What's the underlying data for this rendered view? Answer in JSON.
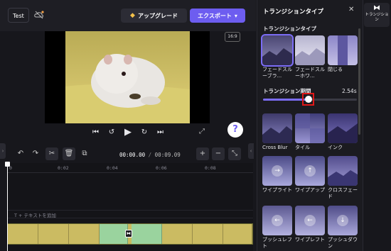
{
  "topbar": {
    "project_name": "Test",
    "upgrade_label": "アップグレード",
    "export_label": "エクスポート",
    "export_chevron": "⌄"
  },
  "preview": {
    "aspect_ratio": "16:9",
    "help_label": "?"
  },
  "timeline": {
    "current_time": "00:00.00",
    "total_time": "00:09.09",
    "ruler_ticks": [
      "0",
      "0:02",
      "0:04",
      "0:06",
      "0:08"
    ],
    "text_track_placeholder": "T  + テキストを追加"
  },
  "panel": {
    "title": "トランジションタイプ",
    "section_label": "トランジションタイプ",
    "duration_label": "トランジション期間",
    "duration_value": "2.54s",
    "duration_fraction": 0.48,
    "transitions": [
      {
        "label": "フェードスルーブラ...",
        "selected": true,
        "colors": [
          "#4a4672",
          "#8e8bb8"
        ]
      },
      {
        "label": "フェードスルーホワ...",
        "selected": false,
        "colors": [
          "#b6b4cf",
          "#eceaf6"
        ]
      },
      {
        "label": "閉じる",
        "selected": false,
        "colors": [
          "#8c86c8",
          "#c4c0e6"
        ]
      },
      {
        "label": "Cross Blur",
        "selected": false,
        "colors": [
          "#3e3a6a",
          "#8a86c6"
        ]
      },
      {
        "label": "タイル",
        "selected": false,
        "colors": [
          "#3f3d78",
          "#9b96d4"
        ]
      },
      {
        "label": "インク",
        "selected": false,
        "colors": [
          "#3a3470",
          "#7c74c0"
        ]
      },
      {
        "label": "ワイプライト",
        "selected": false,
        "colors": [
          "#4b4a86",
          "#a9a8dc"
        ]
      },
      {
        "label": "ワイプアップ",
        "selected": false,
        "colors": [
          "#4b4a86",
          "#a9a8dc"
        ]
      },
      {
        "label": "クロスフェード",
        "selected": false,
        "colors": [
          "#514c8c",
          "#a39ed6"
        ]
      },
      {
        "label": "ブッシュレフト",
        "selected": false,
        "colors": [
          "#5b5890",
          "#b4b2e0"
        ]
      },
      {
        "label": "ワイプレフト",
        "selected": false,
        "colors": [
          "#5b5890",
          "#b4b2e0"
        ]
      },
      {
        "label": "プッシュダウン",
        "selected": false,
        "colors": [
          "#4f4c88",
          "#aaa8da"
        ]
      }
    ],
    "arrow_icons": [
      "→",
      "↑",
      "←",
      "↓"
    ]
  },
  "rail": {
    "tab_label": "トランジション"
  },
  "colors": {
    "accent": "#6d5df0",
    "focus_outline": "#e01818",
    "clip_yellow": "#c9b95e",
    "clip_green": "#9ad39e"
  }
}
